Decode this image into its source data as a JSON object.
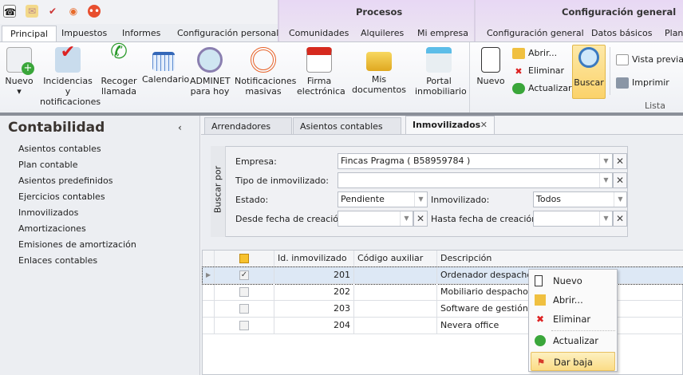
{
  "quick_access": [
    "app-menu-icon",
    "mail-icon",
    "tasks-icon",
    "broadcast-icon",
    "mascot-icon"
  ],
  "context_groups": {
    "procesos": "Procesos",
    "configuracion": "Configuración general"
  },
  "tabs": [
    "Principal",
    "Impuestos",
    "Informes",
    "Configuración personal",
    "Comunidades",
    "Alquileres",
    "Mi empresa",
    "Configuración general",
    "Datos básicos",
    "Plant"
  ],
  "ribbon": {
    "buttons": [
      {
        "label": "Nuevo",
        "icon": "new-doc-icon"
      },
      {
        "label": "Incidencias y notificaciones",
        "icon": "incidents-icon"
      },
      {
        "label": "Recoger llamada",
        "icon": "phone-icon"
      },
      {
        "label": "Calendario",
        "icon": "calendar-icon"
      },
      {
        "label": "ADMINET para hoy",
        "icon": "clock-icon"
      },
      {
        "label": "Notificaciones masivas",
        "icon": "broadcast-icon"
      },
      {
        "label": "Firma electrónica",
        "icon": "pdf-sign-icon"
      },
      {
        "label": "Mis documentos",
        "icon": "folder-icon"
      },
      {
        "label": "Portal inmobiliario",
        "icon": "portal-icon"
      }
    ],
    "lista": {
      "group": "Lista",
      "nuevo": "Nuevo",
      "abrir": "Abrir...",
      "eliminar": "Eliminar",
      "actualizar": "Actualizar",
      "buscar": "Buscar",
      "vista_previa": "Vista previa",
      "imprimir": "Imprimir"
    }
  },
  "sidebar": {
    "title": "Contabilidad",
    "items": [
      "Asientos contables",
      "Plan contable",
      "Asientos predefinidos",
      "Ejercicios contables",
      "Inmovilizados",
      "Amortizaciones",
      "Emisiones de amortización",
      "Enlaces contables"
    ]
  },
  "doc_tabs": [
    "Arrendadores",
    "Asientos contables",
    "Inmovilizados"
  ],
  "search": {
    "label": "Buscar por",
    "empresa_label": "Empresa:",
    "empresa": "Fincas Pragma ( B58959784 )",
    "tipo_label": "Tipo de inmovilizado:",
    "tipo": "",
    "estado_label": "Estado:",
    "estado": "Pendiente",
    "inmov_label": "Inmovilizado:",
    "inmov": "Todos",
    "desde_label": "Desde fecha de creación:",
    "desde": "",
    "hasta_label": "Hasta fecha de creación:",
    "hasta": ""
  },
  "grid": {
    "columns": [
      "Id. inmovilizado",
      "Código auxiliar",
      "Descripción"
    ],
    "rows": [
      {
        "checked": true,
        "id": "201",
        "codigo": "",
        "desc": "Ordenador despacho"
      },
      {
        "checked": false,
        "id": "202",
        "codigo": "",
        "desc": "Mobiliario despacho"
      },
      {
        "checked": false,
        "id": "203",
        "codigo": "",
        "desc": "Software de gestión"
      },
      {
        "checked": false,
        "id": "204",
        "codigo": "",
        "desc": "Nevera office"
      }
    ]
  },
  "context_menu": [
    "Nuevo",
    "Abrir...",
    "Eliminar",
    "Actualizar",
    "Dar baja"
  ],
  "colors": {
    "accent_highlight": "#fbd97a",
    "context_tab_bg": "#e8d8f4",
    "selected_row": "#dde8f5"
  }
}
